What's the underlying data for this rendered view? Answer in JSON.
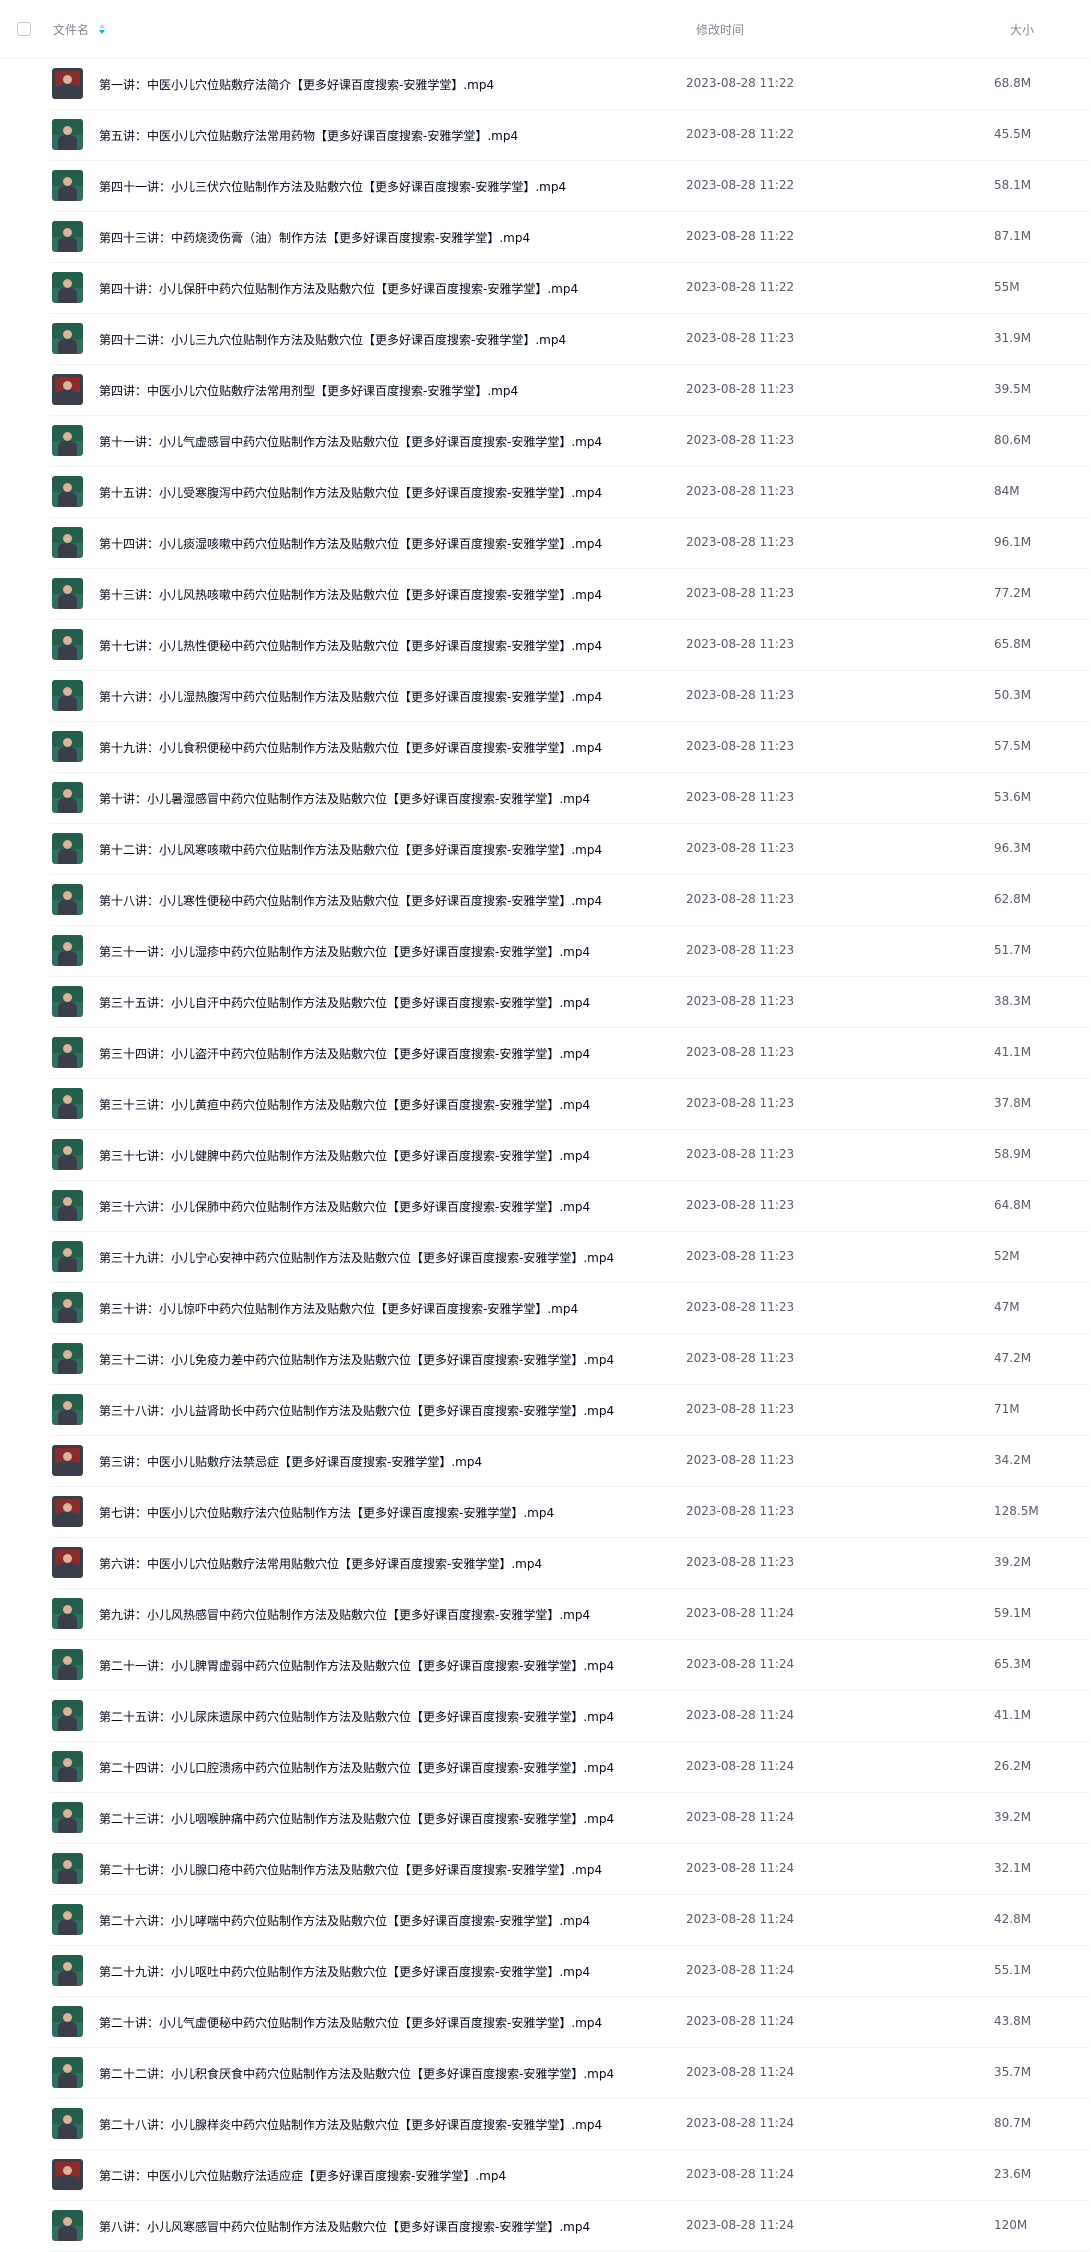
{
  "header": {
    "name_label": "文件名",
    "time_label": "修改时间",
    "size_label": "大小",
    "sort_icon": "sort-icon",
    "accent_color": "#06a7ff"
  },
  "files": [
    {
      "name": "第一讲：中医小儿穴位贴敷疗法简介【更多好课百度搜索-安雅学堂】.mp4",
      "time": "2023-08-28 11:22",
      "size": "68.8M",
      "thumb": "red"
    },
    {
      "name": "第五讲：中医小儿穴位贴敷疗法常用药物【更多好课百度搜索-安雅学堂】.mp4",
      "time": "2023-08-28 11:22",
      "size": "45.5M",
      "thumb": "green"
    },
    {
      "name": "第四十一讲：小儿三伏穴位贴制作方法及贴敷穴位【更多好课百度搜索-安雅学堂】.mp4",
      "time": "2023-08-28 11:22",
      "size": "58.1M",
      "thumb": "green"
    },
    {
      "name": "第四十三讲：中药烧烫伤膏（油）制作方法【更多好课百度搜索-安雅学堂】.mp4",
      "time": "2023-08-28 11:22",
      "size": "87.1M",
      "thumb": "green"
    },
    {
      "name": "第四十讲：小儿保肝中药穴位贴制作方法及贴敷穴位【更多好课百度搜索-安雅学堂】.mp4",
      "time": "2023-08-28 11:22",
      "size": "55M",
      "thumb": "green"
    },
    {
      "name": "第四十二讲：小儿三九穴位贴制作方法及贴敷穴位【更多好课百度搜索-安雅学堂】.mp4",
      "time": "2023-08-28 11:23",
      "size": "31.9M",
      "thumb": "green"
    },
    {
      "name": "第四讲：中医小儿穴位贴敷疗法常用剂型【更多好课百度搜索-安雅学堂】.mp4",
      "time": "2023-08-28 11:23",
      "size": "39.5M",
      "thumb": "red"
    },
    {
      "name": "第十一讲：小儿气虚感冒中药穴位贴制作方法及贴敷穴位【更多好课百度搜索-安雅学堂】.mp4",
      "time": "2023-08-28 11:23",
      "size": "80.6M",
      "thumb": "green"
    },
    {
      "name": "第十五讲：小儿受寒腹泻中药穴位贴制作方法及贴敷穴位【更多好课百度搜索-安雅学堂】.mp4",
      "time": "2023-08-28 11:23",
      "size": "84M",
      "thumb": "green"
    },
    {
      "name": "第十四讲：小儿痰湿咳嗽中药穴位贴制作方法及贴敷穴位【更多好课百度搜索-安雅学堂】.mp4",
      "time": "2023-08-28 11:23",
      "size": "96.1M",
      "thumb": "green"
    },
    {
      "name": "第十三讲：小儿风热咳嗽中药穴位贴制作方法及贴敷穴位【更多好课百度搜索-安雅学堂】.mp4",
      "time": "2023-08-28 11:23",
      "size": "77.2M",
      "thumb": "green"
    },
    {
      "name": "第十七讲：小儿热性便秘中药穴位贴制作方法及贴敷穴位【更多好课百度搜索-安雅学堂】.mp4",
      "time": "2023-08-28 11:23",
      "size": "65.8M",
      "thumb": "green"
    },
    {
      "name": "第十六讲：小儿湿热腹泻中药穴位贴制作方法及贴敷穴位【更多好课百度搜索-安雅学堂】.mp4",
      "time": "2023-08-28 11:23",
      "size": "50.3M",
      "thumb": "green"
    },
    {
      "name": "第十九讲：小儿食积便秘中药穴位贴制作方法及贴敷穴位【更多好课百度搜索-安雅学堂】.mp4",
      "time": "2023-08-28 11:23",
      "size": "57.5M",
      "thumb": "green"
    },
    {
      "name": "第十讲：小儿暑湿感冒中药穴位贴制作方法及贴敷穴位【更多好课百度搜索-安雅学堂】.mp4",
      "time": "2023-08-28 11:23",
      "size": "53.6M",
      "thumb": "green"
    },
    {
      "name": "第十二讲：小儿风寒咳嗽中药穴位贴制作方法及贴敷穴位【更多好课百度搜索-安雅学堂】.mp4",
      "time": "2023-08-28 11:23",
      "size": "96.3M",
      "thumb": "green"
    },
    {
      "name": "第十八讲：小儿寒性便秘中药穴位贴制作方法及贴敷穴位【更多好课百度搜索-安雅学堂】.mp4",
      "time": "2023-08-28 11:23",
      "size": "62.8M",
      "thumb": "green"
    },
    {
      "name": "第三十一讲：小儿湿疹中药穴位贴制作方法及贴敷穴位【更多好课百度搜索-安雅学堂】.mp4",
      "time": "2023-08-28 11:23",
      "size": "51.7M",
      "thumb": "green"
    },
    {
      "name": "第三十五讲：小儿自汗中药穴位贴制作方法及贴敷穴位【更多好课百度搜索-安雅学堂】.mp4",
      "time": "2023-08-28 11:23",
      "size": "38.3M",
      "thumb": "green"
    },
    {
      "name": "第三十四讲：小儿盗汗中药穴位贴制作方法及贴敷穴位【更多好课百度搜索-安雅学堂】.mp4",
      "time": "2023-08-28 11:23",
      "size": "41.1M",
      "thumb": "green"
    },
    {
      "name": "第三十三讲：小儿黄疸中药穴位贴制作方法及贴敷穴位【更多好课百度搜索-安雅学堂】.mp4",
      "time": "2023-08-28 11:23",
      "size": "37.8M",
      "thumb": "green"
    },
    {
      "name": "第三十七讲：小儿健脾中药穴位贴制作方法及贴敷穴位【更多好课百度搜索-安雅学堂】.mp4",
      "time": "2023-08-28 11:23",
      "size": "58.9M",
      "thumb": "green"
    },
    {
      "name": "第三十六讲：小儿保肺中药穴位贴制作方法及贴敷穴位【更多好课百度搜索-安雅学堂】.mp4",
      "time": "2023-08-28 11:23",
      "size": "64.8M",
      "thumb": "green"
    },
    {
      "name": "第三十九讲：小儿宁心安神中药穴位贴制作方法及贴敷穴位【更多好课百度搜索-安雅学堂】.mp4",
      "time": "2023-08-28 11:23",
      "size": "52M",
      "thumb": "green"
    },
    {
      "name": "第三十讲：小儿惊吓中药穴位贴制作方法及贴敷穴位【更多好课百度搜索-安雅学堂】.mp4",
      "time": "2023-08-28 11:23",
      "size": "47M",
      "thumb": "green"
    },
    {
      "name": "第三十二讲：小儿免疫力差中药穴位贴制作方法及贴敷穴位【更多好课百度搜索-安雅学堂】.mp4",
      "time": "2023-08-28 11:23",
      "size": "47.2M",
      "thumb": "green"
    },
    {
      "name": "第三十八讲：小儿益肾助长中药穴位贴制作方法及贴敷穴位【更多好课百度搜索-安雅学堂】.mp4",
      "time": "2023-08-28 11:23",
      "size": "71M",
      "thumb": "green"
    },
    {
      "name": "第三讲：中医小儿贴敷疗法禁忌症【更多好课百度搜索-安雅学堂】.mp4",
      "time": "2023-08-28 11:23",
      "size": "34.2M",
      "thumb": "red"
    },
    {
      "name": "第七讲：中医小儿穴位贴敷疗法穴位贴制作方法【更多好课百度搜索-安雅学堂】.mp4",
      "time": "2023-08-28 11:23",
      "size": "128.5M",
      "thumb": "red"
    },
    {
      "name": "第六讲：中医小儿穴位贴敷疗法常用贴敷穴位【更多好课百度搜索-安雅学堂】.mp4",
      "time": "2023-08-28 11:23",
      "size": "39.2M",
      "thumb": "red"
    },
    {
      "name": "第九讲：小儿风热感冒中药穴位贴制作方法及贴敷穴位【更多好课百度搜索-安雅学堂】.mp4",
      "time": "2023-08-28 11:24",
      "size": "59.1M",
      "thumb": "green"
    },
    {
      "name": "第二十一讲：小儿脾胃虚弱中药穴位贴制作方法及贴敷穴位【更多好课百度搜索-安雅学堂】.mp4",
      "time": "2023-08-28 11:24",
      "size": "65.3M",
      "thumb": "green"
    },
    {
      "name": "第二十五讲：小儿尿床遗尿中药穴位贴制作方法及贴敷穴位【更多好课百度搜索-安雅学堂】.mp4",
      "time": "2023-08-28 11:24",
      "size": "41.1M",
      "thumb": "green"
    },
    {
      "name": "第二十四讲：小儿口腔溃疡中药穴位贴制作方法及贴敷穴位【更多好课百度搜索-安雅学堂】.mp4",
      "time": "2023-08-28 11:24",
      "size": "26.2M",
      "thumb": "green"
    },
    {
      "name": "第二十三讲：小儿咽喉肿痛中药穴位贴制作方法及贴敷穴位【更多好课百度搜索-安雅学堂】.mp4",
      "time": "2023-08-28 11:24",
      "size": "39.2M",
      "thumb": "green"
    },
    {
      "name": "第二十七讲：小儿腺口疮中药穴位贴制作方法及贴敷穴位【更多好课百度搜索-安雅学堂】.mp4",
      "time": "2023-08-28 11:24",
      "size": "32.1M",
      "thumb": "green"
    },
    {
      "name": "第二十六讲：小儿哮喘中药穴位贴制作方法及贴敷穴位【更多好课百度搜索-安雅学堂】.mp4",
      "time": "2023-08-28 11:24",
      "size": "42.8M",
      "thumb": "green"
    },
    {
      "name": "第二十九讲：小儿呕吐中药穴位贴制作方法及贴敷穴位【更多好课百度搜索-安雅学堂】.mp4",
      "time": "2023-08-28 11:24",
      "size": "55.1M",
      "thumb": "green"
    },
    {
      "name": "第二十讲：小儿气虚便秘中药穴位贴制作方法及贴敷穴位【更多好课百度搜索-安雅学堂】.mp4",
      "time": "2023-08-28 11:24",
      "size": "43.8M",
      "thumb": "green"
    },
    {
      "name": "第二十二讲：小儿积食厌食中药穴位贴制作方法及贴敷穴位【更多好课百度搜索-安雅学堂】.mp4",
      "time": "2023-08-28 11:24",
      "size": "35.7M",
      "thumb": "green"
    },
    {
      "name": "第二十八讲：小儿腺样炎中药穴位贴制作方法及贴敷穴位【更多好课百度搜索-安雅学堂】.mp4",
      "time": "2023-08-28 11:24",
      "size": "80.7M",
      "thumb": "green"
    },
    {
      "name": "第二讲：中医小儿穴位贴敷疗法适应症【更多好课百度搜索-安雅学堂】.mp4",
      "time": "2023-08-28 11:24",
      "size": "23.6M",
      "thumb": "red"
    },
    {
      "name": "第八讲：小儿风寒感冒中药穴位贴制作方法及贴敷穴位【更多好课百度搜索-安雅学堂】.mp4",
      "time": "2023-08-28 11:24",
      "size": "120M",
      "thumb": "green"
    }
  ]
}
